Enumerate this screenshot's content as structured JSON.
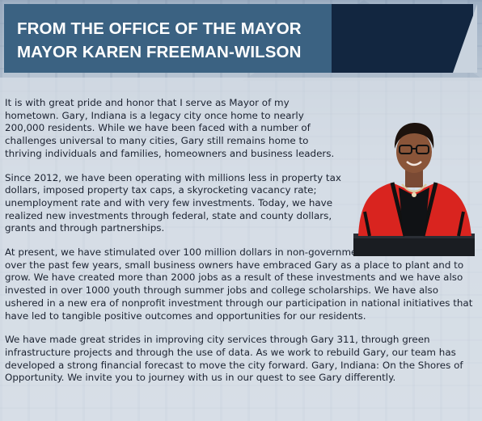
{
  "header": {
    "line1": "FROM THE OFFICE OF THE MAYOR",
    "line2": "MAYOR KAREN FREEMAN-WILSON"
  },
  "colors": {
    "title_bg": "#3b6282",
    "title_dark": "#122640",
    "portrait_jacket": "#d9241f"
  },
  "body": {
    "paragraphs": [
      "It is with great pride and honor that I serve as Mayor of my hometown. Gary, Indiana is a legacy city once home to nearly 200,000 residents.  While we have been faced with a number of challenges universal to many cities, Gary still remains home to thriving individuals and families, homeowners and business leaders.",
      "Since 2012, we have been operating with millions less in property tax dollars, imposed property tax caps, a skyrocketing vacancy rate; unemployment rate and with very few investments.  Today, we have realized new investments through federal, state and county dollars, grants and through partnerships.",
      "At present, we have stimulated over 100 million dollars in non-governmental investment and over the past few years, small business owners have embraced Gary as a place to plant and to grow.  We have created more than 2000 jobs as a result of these investments and we have also invested in over 1000 youth through summer jobs and college scholarships. We have also ushered in a new era of nonprofit investment through our participation in national initiatives that have led to tangible positive outcomes and opportunities for our residents.",
      "We have made great strides in improving city services through Gary 311, through green infrastructure projects and through the use of data.  As we work to rebuild Gary, our team has developed a strong financial forecast to move the city forward.  Gary, Indiana: On the Shores of Opportunity.  We invite you to journey with us in our quest to see Gary differently."
    ]
  },
  "portrait": {
    "icon": "mayor-portrait"
  }
}
